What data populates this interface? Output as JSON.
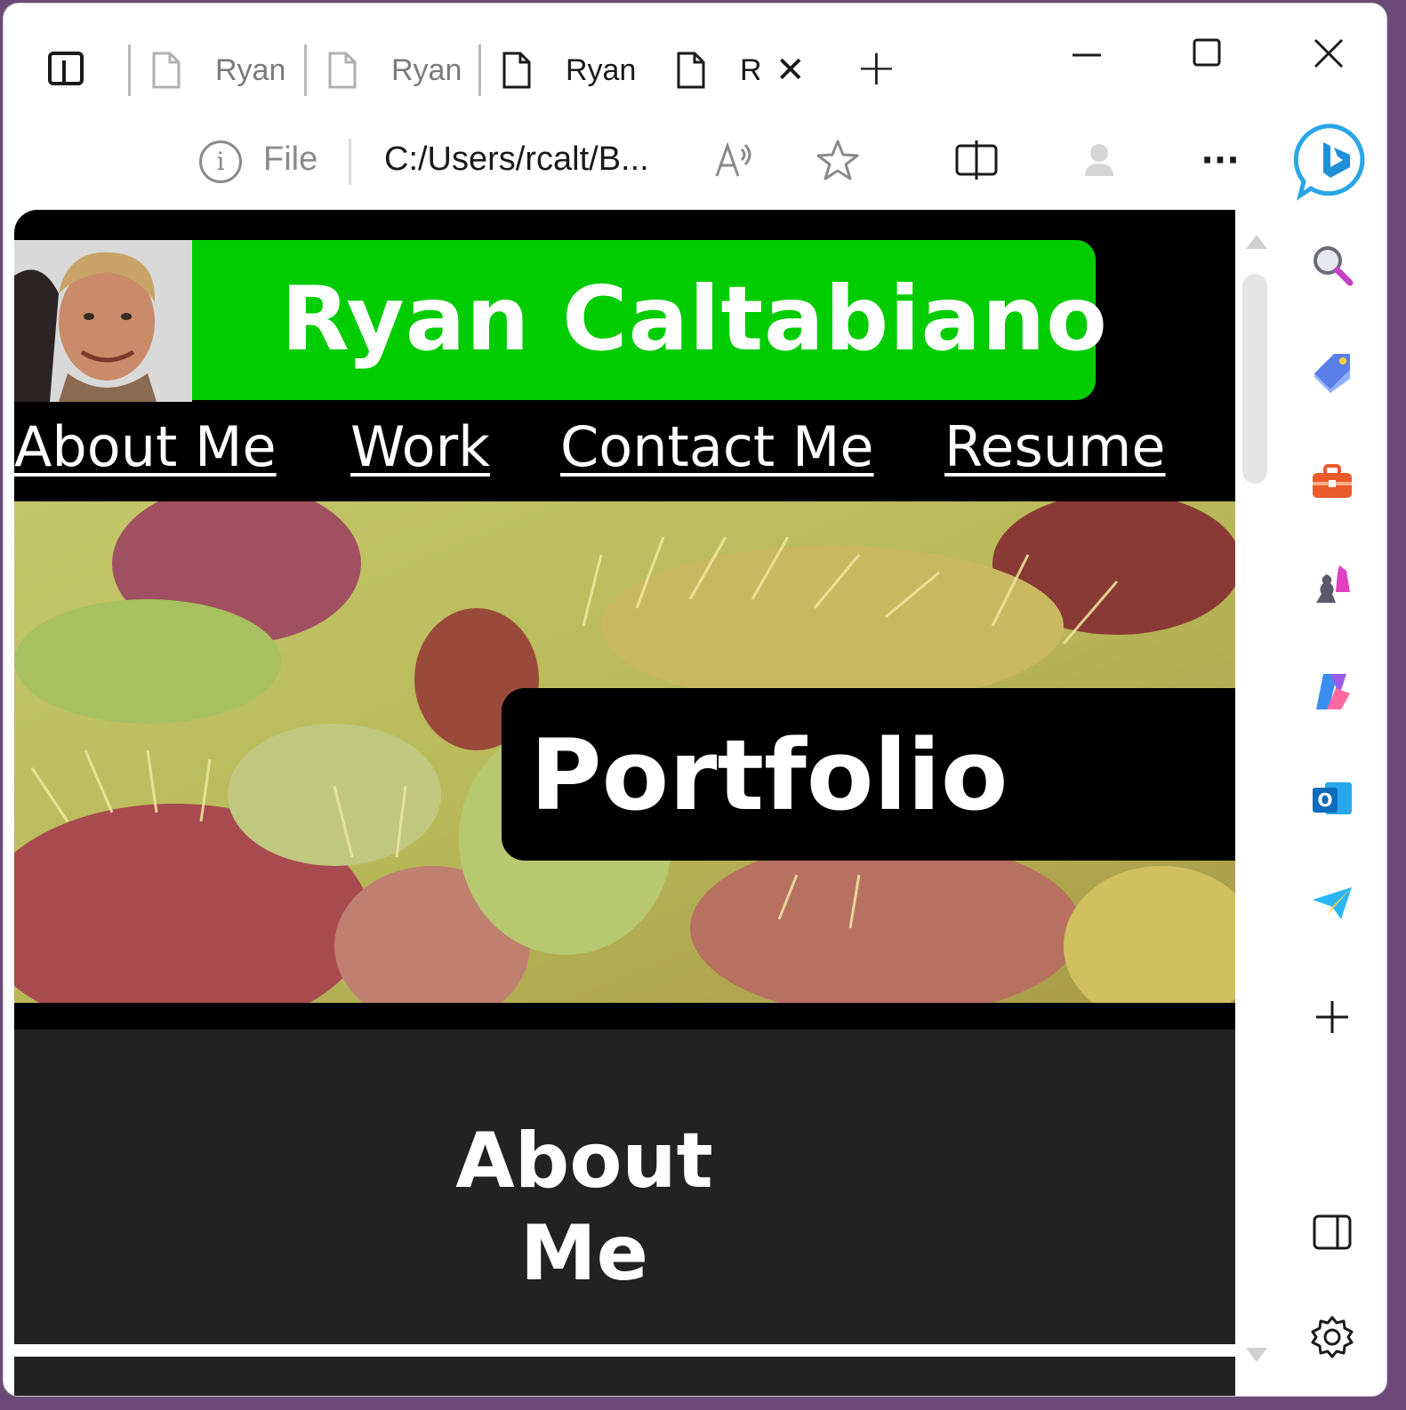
{
  "browser": {
    "tabs": [
      {
        "label": "Ryan",
        "state": "inactive"
      },
      {
        "label": "Ryan",
        "state": "inactive"
      },
      {
        "label": "Ryan",
        "state": "active"
      },
      {
        "label": "R",
        "state": "current"
      }
    ],
    "new_tab_glyph": "+",
    "close_tab_glyph": "✕",
    "window_controls": {
      "minimize": "—",
      "maximize": "☐",
      "close": "✕"
    },
    "address": {
      "scheme_label": "File",
      "url": "C:/Users/rcalt/B..."
    },
    "more_glyph": "···",
    "sidebar_icons": [
      "bing-chat-icon",
      "search-icon",
      "shopping-tag-icon",
      "tools-icon",
      "games-icon",
      "copilot-icon",
      "outlook-icon",
      "send-icon",
      "add-icon",
      "sidebar-toggle-icon",
      "settings-icon"
    ]
  },
  "page": {
    "site_title": "Ryan Caltabiano",
    "nav": [
      {
        "label": "About Me"
      },
      {
        "label": "Work"
      },
      {
        "label": "Contact Me"
      },
      {
        "label": "Resume"
      }
    ],
    "hero_heading": "Portfolio",
    "about_heading": "About Me",
    "colors": {
      "name_plate": "#00cc00",
      "background": "#000000",
      "section": "#222222"
    }
  }
}
